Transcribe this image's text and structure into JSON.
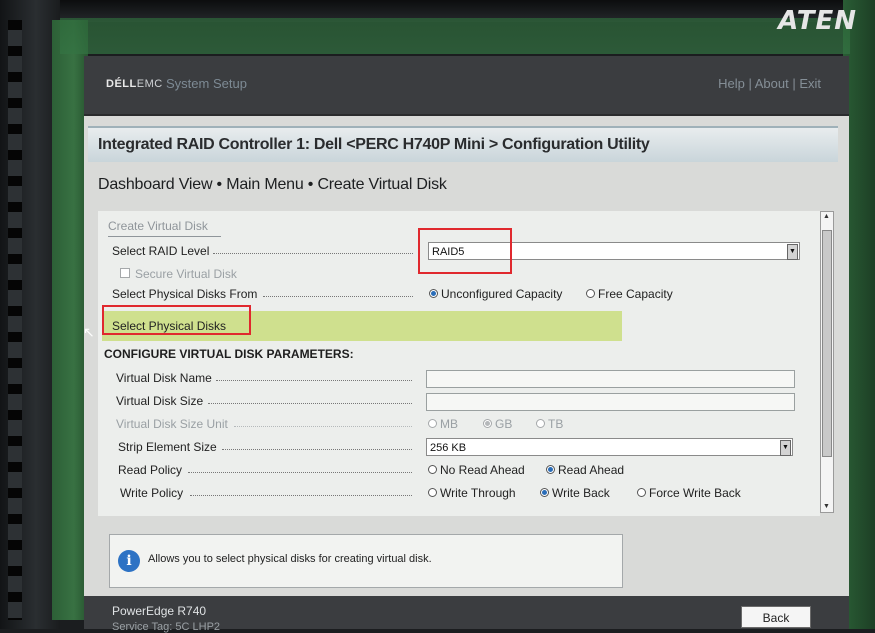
{
  "brand_overlay": {
    "aten": "ATEN"
  },
  "header": {
    "logo_bold": "DÉLL",
    "logo_light": "EMC",
    "app_title": "System Setup",
    "links": [
      "Help",
      "About",
      "Exit"
    ]
  },
  "title": "Integrated RAID Controller 1: Dell <PERC H740P Mini > Configuration Utility",
  "breadcrumb": "Dashboard View • Main Menu • Create Virtual Disk",
  "form": {
    "section_tab": "Create Virtual Disk",
    "raid_level": {
      "label": "Select RAID Level",
      "value": "RAID5"
    },
    "secure_virtual_disk": {
      "label": "Secure Virtual Disk",
      "checked": false
    },
    "physical_disks_from": {
      "label": "Select Physical Disks From",
      "options": [
        "Unconfigured Capacity",
        "Free Capacity"
      ],
      "selected": "Unconfigured Capacity"
    },
    "select_physical_disks": "Select Physical Disks",
    "params_heading": "CONFIGURE VIRTUAL DISK PARAMETERS:",
    "vd_name": {
      "label": "Virtual Disk Name",
      "value": ""
    },
    "vd_size": {
      "label": "Virtual Disk Size",
      "value": ""
    },
    "vd_size_unit": {
      "label": "Virtual Disk Size Unit",
      "options": [
        "MB",
        "GB",
        "TB"
      ],
      "selected": "GB"
    },
    "strip_size": {
      "label": "Strip Element Size",
      "value": "256 KB"
    },
    "read_policy": {
      "label": "Read Policy",
      "options": [
        "No Read Ahead",
        "Read Ahead"
      ],
      "selected": "Read Ahead"
    },
    "write_policy": {
      "label": "Write Policy",
      "options": [
        "Write Through",
        "Write Back",
        "Force Write Back"
      ],
      "selected": "Write Back"
    }
  },
  "help_text": "Allows you to select physical disks for creating virtual disk.",
  "footer": {
    "model": "PowerEdge R740",
    "service_tag": "Service Tag: 5C LHP2",
    "back_label": "Back"
  },
  "colors": {
    "highlight": "#cfe08e",
    "annotation_red": "#e0282e",
    "radio_selected": "#2a6db8"
  }
}
